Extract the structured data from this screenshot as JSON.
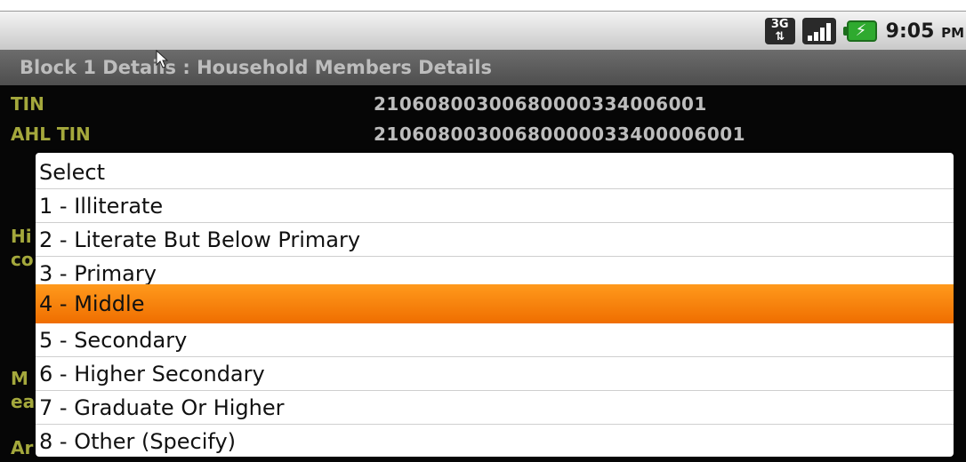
{
  "status_bar": {
    "network_badge": "3G",
    "time": "9:05",
    "ampm": "PM"
  },
  "screen_title": "Block 1 Details : Household Members Details",
  "fields": [
    {
      "label": "TIN",
      "value": "21060800300680000334006001"
    },
    {
      "label": "AHL TIN",
      "value": "21060800300680000033400006001"
    }
  ],
  "background_fragments": [
    "Hi",
    "co",
    "M",
    "ea",
    "Ar"
  ],
  "dropdown": {
    "options": [
      "Select",
      "1 - Illiterate",
      "2 - Literate But Below Primary",
      "3 - Primary",
      "4 - Middle",
      "5 - Secondary",
      "6 - Higher Secondary",
      "7 - Graduate Or Higher",
      "8 - Other (Specify)"
    ],
    "selected_index": 4
  },
  "colors": {
    "selected_option": "#f57f0a",
    "field_label": "#a4a83c",
    "field_value": "#bdbdbd",
    "title_text": "#bdbdbd"
  },
  "icons": [
    "3g-icon",
    "signal-icon",
    "battery-charging-icon",
    "mouse-cursor-icon"
  ]
}
